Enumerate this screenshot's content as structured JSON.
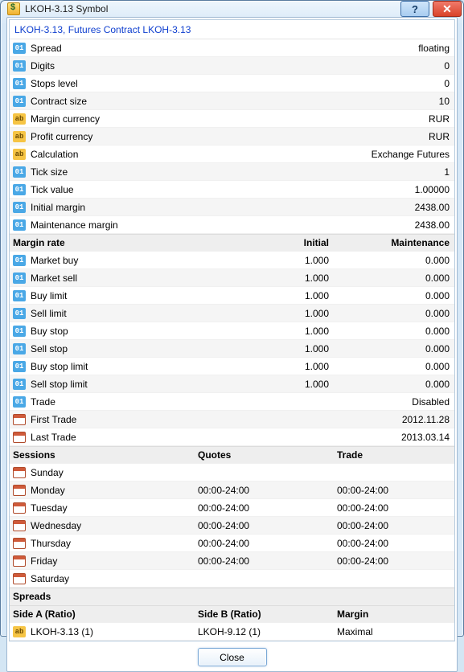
{
  "window": {
    "title": "LKOH-3.13 Symbol"
  },
  "header_title": "LKOH-3.13, Futures Contract LKOH-3.13",
  "props": [
    {
      "icon": "num",
      "label": "Spread",
      "value": "floating"
    },
    {
      "icon": "num",
      "label": "Digits",
      "value": "0"
    },
    {
      "icon": "num",
      "label": "Stops level",
      "value": "0"
    },
    {
      "icon": "num",
      "label": "Contract size",
      "value": "10"
    },
    {
      "icon": "str",
      "label": "Margin currency",
      "value": "RUR"
    },
    {
      "icon": "str",
      "label": "Profit currency",
      "value": "RUR"
    },
    {
      "icon": "str",
      "label": "Calculation",
      "value": "Exchange Futures"
    },
    {
      "icon": "num",
      "label": "Tick size",
      "value": "1"
    },
    {
      "icon": "num",
      "label": "Tick value",
      "value": "1.00000"
    },
    {
      "icon": "num",
      "label": "Initial margin",
      "value": "2438.00"
    },
    {
      "icon": "num",
      "label": "Maintenance margin",
      "value": "2438.00"
    }
  ],
  "margin_rate": {
    "header": {
      "c1": "Margin rate",
      "c2": "Initial",
      "c3": "Maintenance"
    },
    "rows": [
      {
        "icon": "num",
        "label": "Market buy",
        "initial": "1.000",
        "maint": "0.000"
      },
      {
        "icon": "num",
        "label": "Market sell",
        "initial": "1.000",
        "maint": "0.000"
      },
      {
        "icon": "num",
        "label": "Buy limit",
        "initial": "1.000",
        "maint": "0.000"
      },
      {
        "icon": "num",
        "label": "Sell limit",
        "initial": "1.000",
        "maint": "0.000"
      },
      {
        "icon": "num",
        "label": "Buy stop",
        "initial": "1.000",
        "maint": "0.000"
      },
      {
        "icon": "num",
        "label": "Sell stop",
        "initial": "1.000",
        "maint": "0.000"
      },
      {
        "icon": "num",
        "label": "Buy stop limit",
        "initial": "1.000",
        "maint": "0.000"
      },
      {
        "icon": "num",
        "label": "Sell stop limit",
        "initial": "1.000",
        "maint": "0.000"
      }
    ]
  },
  "trade": [
    {
      "icon": "num",
      "label": "Trade",
      "value": "Disabled"
    },
    {
      "icon": "cal",
      "label": "First Trade",
      "value": "2012.11.28"
    },
    {
      "icon": "cal",
      "label": "Last Trade",
      "value": "2013.03.14"
    }
  ],
  "sessions": {
    "header": {
      "c1": "Sessions",
      "c2": "Quotes",
      "c3": "Trade"
    },
    "rows": [
      {
        "day": "Sunday",
        "quotes": "",
        "trade": ""
      },
      {
        "day": "Monday",
        "quotes": "00:00-24:00",
        "trade": "00:00-24:00"
      },
      {
        "day": "Tuesday",
        "quotes": "00:00-24:00",
        "trade": "00:00-24:00"
      },
      {
        "day": "Wednesday",
        "quotes": "00:00-24:00",
        "trade": "00:00-24:00"
      },
      {
        "day": "Thursday",
        "quotes": "00:00-24:00",
        "trade": "00:00-24:00"
      },
      {
        "day": "Friday",
        "quotes": "00:00-24:00",
        "trade": "00:00-24:00"
      },
      {
        "day": "Saturday",
        "quotes": "",
        "trade": ""
      }
    ]
  },
  "spreads": {
    "title": "Spreads",
    "header": {
      "c1": "Side A (Ratio)",
      "c2": "Side B (Ratio)",
      "c3": "Margin"
    },
    "rows": [
      {
        "a": "LKOH-3.13 (1)",
        "b": "LKOH-9.12 (1)",
        "margin": "Maximal"
      }
    ]
  },
  "buttons": {
    "close": "Close"
  }
}
